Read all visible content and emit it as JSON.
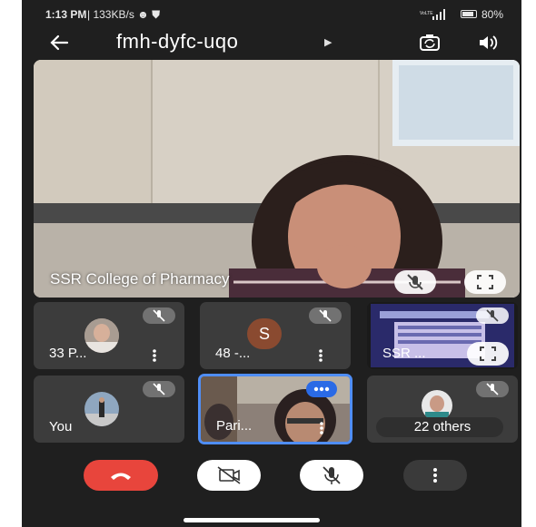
{
  "status_bar": {
    "time": "1:13 PM",
    "network_speed": "133KB/s",
    "battery_pct": "80%",
    "icons": [
      "notification-icon",
      "shield-icon",
      "volte-icon",
      "signal-icon",
      "battery-icon"
    ]
  },
  "header": {
    "meeting_code": "fmh-dyfc-uqo",
    "icons": [
      "back-arrow-icon",
      "caret-right-icon",
      "switch-camera-icon",
      "speaker-icon"
    ]
  },
  "main_tile": {
    "name": "SSR College of Pharmacy",
    "icons": [
      "mic-off-icon",
      "fullscreen-icon"
    ]
  },
  "participants": [
    {
      "name": "33 P...",
      "muted": true
    },
    {
      "name": "48 -...",
      "avatar_letter": "S",
      "muted": true
    },
    {
      "name": "SSR ...",
      "muted": true,
      "presenting": true
    },
    {
      "name": "You",
      "muted": true
    },
    {
      "name": "Pari...",
      "speaking": true
    },
    {
      "name": "22 others",
      "muted": true
    }
  ],
  "controls": {
    "icons": [
      "end-call-icon",
      "camera-off-icon",
      "mic-off-icon",
      "more-options-icon"
    ]
  },
  "colors": {
    "background": "#1f1f1f",
    "tile": "#3c3c3c",
    "end_call": "#e8453c",
    "speaking_accent": "#2a6ae6"
  }
}
